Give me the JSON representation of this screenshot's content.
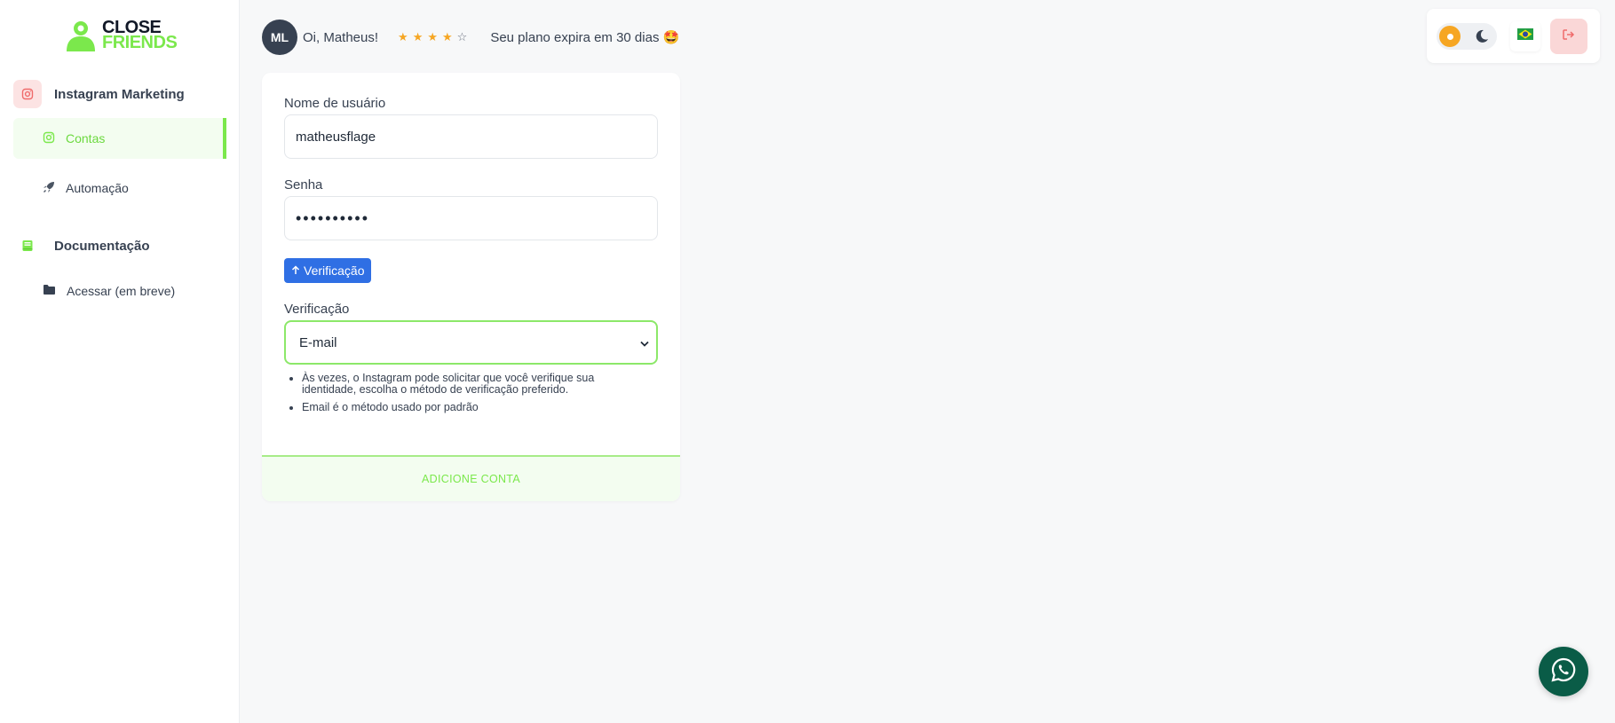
{
  "app": {
    "logo_line1": "CLOSE",
    "logo_line2": "FRIENDS",
    "brand_color": "#7be84c"
  },
  "sidebar": {
    "sections": [
      {
        "label": "Instagram Marketing",
        "icon": "instagram-icon",
        "items": [
          {
            "label": "Contas",
            "icon": "instagram-icon",
            "active": true
          },
          {
            "label": "Automação",
            "icon": "rocket-icon",
            "active": false
          }
        ]
      },
      {
        "label": "Documentação",
        "icon": "book-icon",
        "items": [
          {
            "label": "Acessar (em breve)",
            "icon": "folder-icon",
            "active": false
          }
        ]
      }
    ]
  },
  "header": {
    "avatar_initials": "ML",
    "greeting": "Oi, Matheus!",
    "rating": {
      "filled": 4,
      "total": 5
    },
    "plan_text": "Seu plano expira em 30 dias 🤩"
  },
  "controls": {
    "theme": "light",
    "language_flag": "flag-brazil-icon",
    "logout_icon": "logout-icon"
  },
  "form": {
    "username_label": "Nome de usuário",
    "username_value": "matheusflage",
    "password_label": "Senha",
    "password_value": "••••••••••",
    "verify_button_label": "Verificação",
    "verification_label": "Verificação",
    "verification_selected": "E-mail",
    "hints": [
      "Às vezes, o Instagram pode solicitar que você verifique sua identidade, escolha o método de verificação preferido.",
      "Email é o método usado por padrão"
    ],
    "submit_label": "ADICIONE CONTA"
  }
}
